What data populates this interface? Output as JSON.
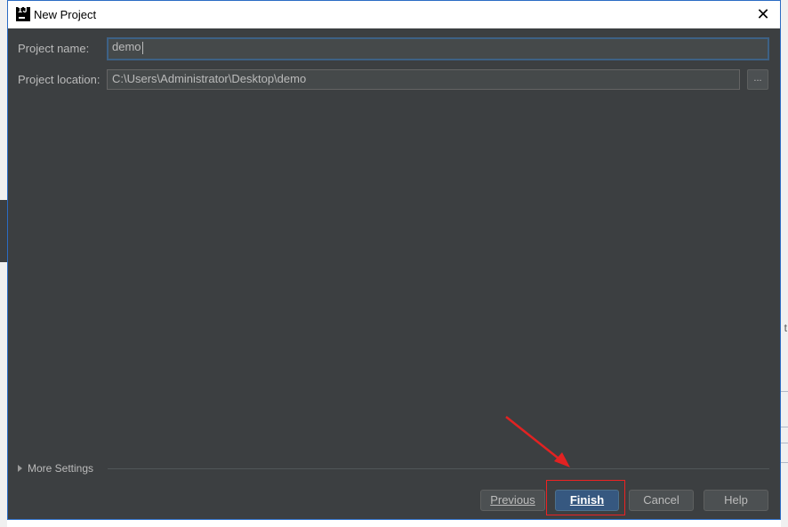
{
  "dialog": {
    "title": "New Project",
    "close_glyph": "✕",
    "fields": {
      "project_name_label": "Project name:",
      "project_name_value": "demo",
      "project_location_label": "Project location:",
      "project_location_value": "C:\\Users\\Administrator\\Desktop\\demo",
      "browse_label": "..."
    },
    "more_settings_label": "More Settings",
    "buttons": {
      "previous": "Previous",
      "finish": "Finish",
      "cancel": "Cancel",
      "help": "Help"
    }
  },
  "background": {
    "right_edge_text": "t"
  },
  "colors": {
    "dialog_bg": "#3c3f41",
    "accent": "#365880",
    "annotation": "#e22222"
  },
  "icons": [
    "intellij-app-icon",
    "close-icon",
    "browse-icon",
    "expand-triangle-icon",
    "annotation-arrow-icon"
  ]
}
